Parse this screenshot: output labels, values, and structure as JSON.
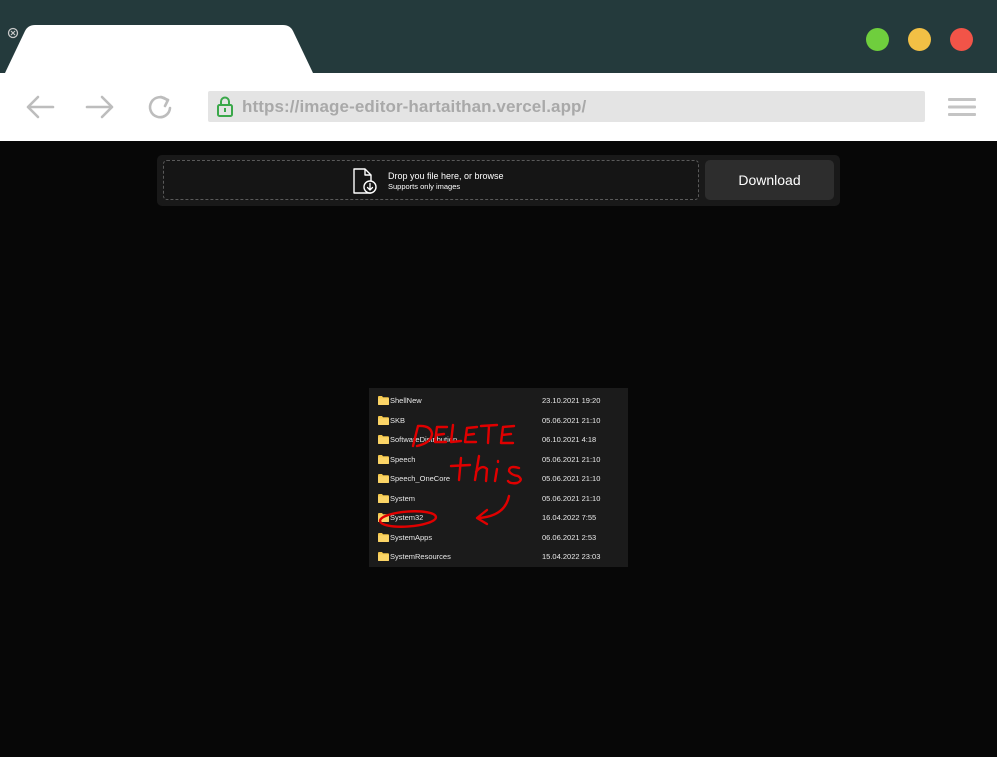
{
  "browser": {
    "url": "https://image-editor-hartaithan.vercel.app/",
    "icons": {
      "back": "arrow-left-icon",
      "forward": "arrow-right-icon",
      "reload": "reload-icon",
      "lock": "lock-icon",
      "menu": "hamburger-menu-icon",
      "tab_close": "close-icon"
    },
    "colors": {
      "titlebar": "#243a3c",
      "close": "#f25448",
      "minimize": "#f2c045",
      "maximize": "#6fce3d",
      "lock": "#3aa84a"
    }
  },
  "uploader": {
    "drop_text": "Drop you file here, or browse",
    "drop_subtext": "Supports only images",
    "download_label": "Download",
    "icon": "file-download-icon"
  },
  "preview": {
    "rows": [
      {
        "name": "ShellNew",
        "date": "23.10.2021 19:20"
      },
      {
        "name": "SKB",
        "date": "05.06.2021 21:10"
      },
      {
        "name": "SoftwareDistribution",
        "date": "06.10.2021 4:18"
      },
      {
        "name": "Speech",
        "date": "05.06.2021 21:10"
      },
      {
        "name": "Speech_OneCore",
        "date": "05.06.2021 21:10"
      },
      {
        "name": "System",
        "date": "05.06.2021 21:10"
      },
      {
        "name": "System32",
        "date": "16.04.2022 7:55"
      },
      {
        "name": "SystemApps",
        "date": "06.06.2021 2:53"
      },
      {
        "name": "SystemResources",
        "date": "15.04.2022 23:03"
      }
    ],
    "annotation": "DELETE this",
    "annotation_color": "#e00000"
  }
}
